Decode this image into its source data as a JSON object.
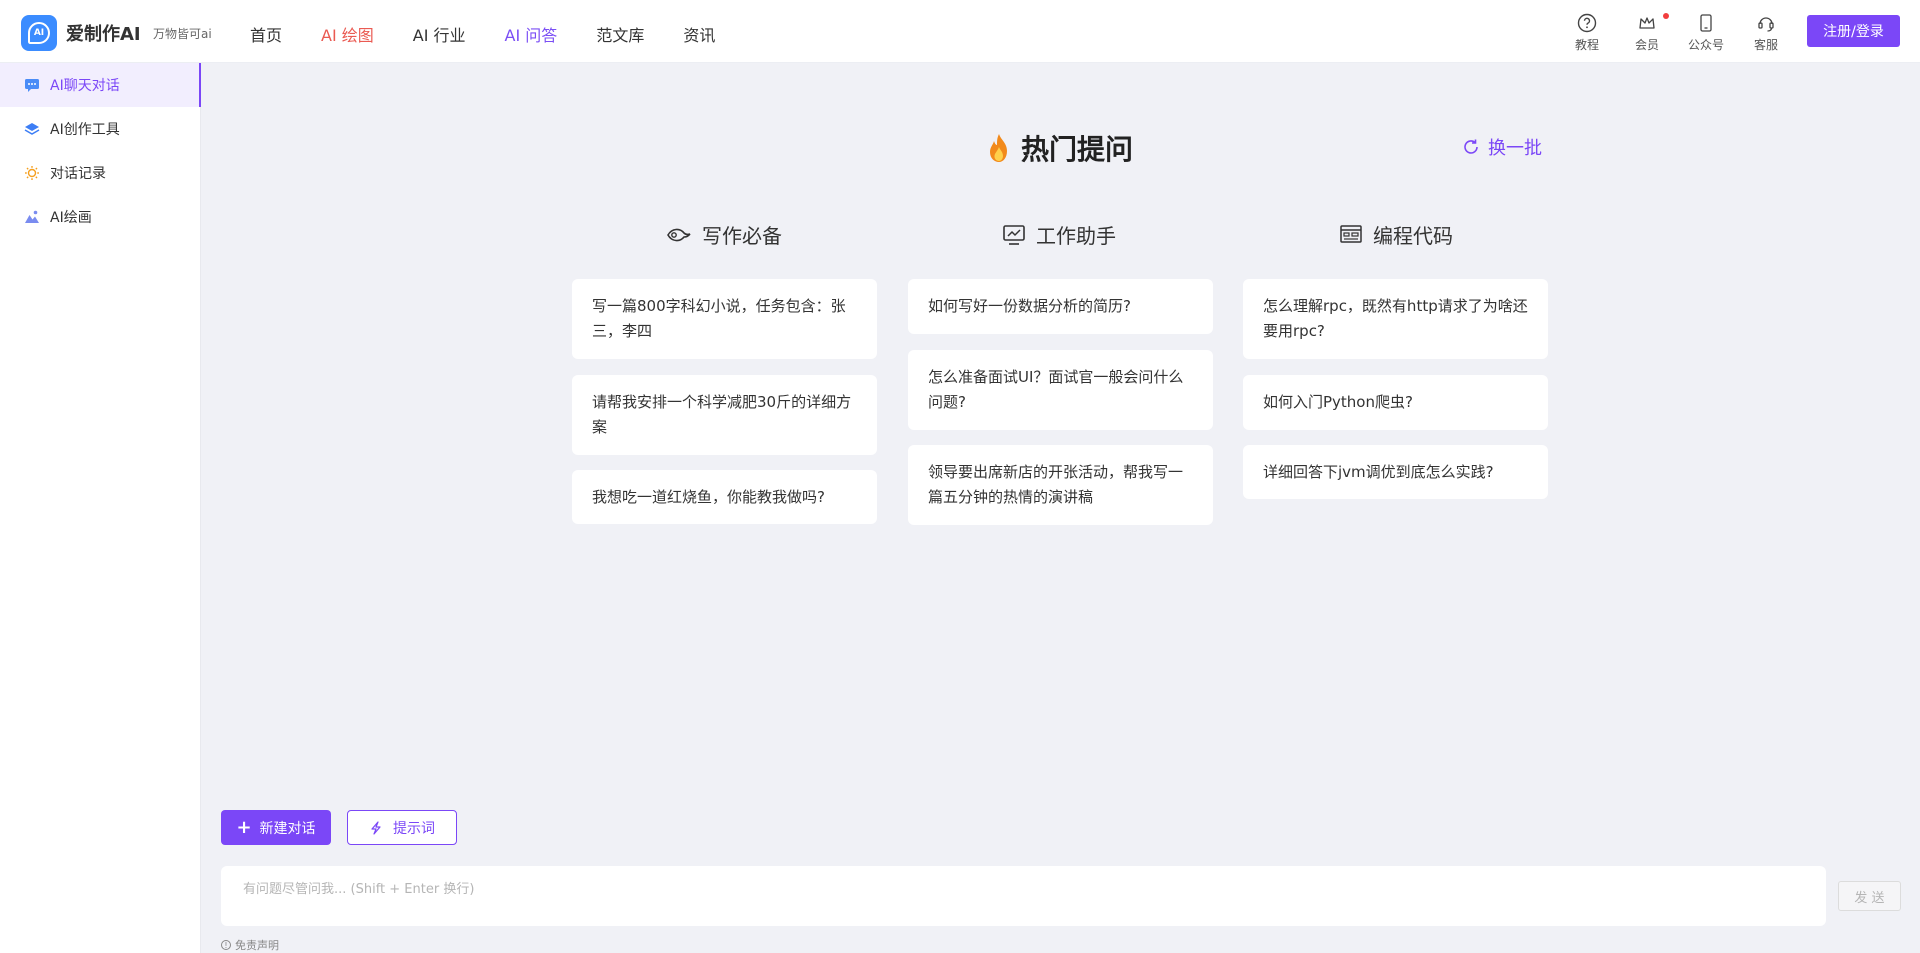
{
  "header": {
    "logo_text": "AI",
    "brand": "爱制作AI",
    "slogan": "万物皆可ai",
    "nav": [
      "首页",
      "AI 绘图",
      "AI 行业",
      "AI 问答",
      "范文库",
      "资讯"
    ],
    "tools": [
      "教程",
      "会员",
      "公众号",
      "客服"
    ],
    "login": "注册/登录"
  },
  "sidebar": {
    "items": [
      {
        "label": "AI聊天对话",
        "icon": "chat-icon"
      },
      {
        "label": "AI创作工具",
        "icon": "layers-icon"
      },
      {
        "label": "对话记录",
        "icon": "lightbulb-icon"
      },
      {
        "label": "AI绘画",
        "icon": "image-icon"
      }
    ]
  },
  "main": {
    "title": "热门提问",
    "refresh": "换一批",
    "columns": [
      {
        "title": "写作必备",
        "icon": "pen-icon",
        "cards": [
          "写一篇800字科幻小说，任务包含：张三，李四",
          "请帮我安排一个科学减肥30斤的详细方案",
          "我想吃一道红烧鱼，你能教我做吗?"
        ]
      },
      {
        "title": "工作助手",
        "icon": "monitor-icon",
        "cards": [
          "如何写好一份数据分析的简历?",
          "怎么准备面试UI？面试官一般会问什么问题?",
          "领导要出席新店的开张活动，帮我写一篇五分钟的热情的演讲稿"
        ]
      },
      {
        "title": "编程代码",
        "icon": "code-icon",
        "cards": [
          "怎么理解rpc，既然有http请求了为啥还要用rpc?",
          "如何入门Python爬虫?",
          "详细回答下jvm调优到底怎么实践?"
        ]
      }
    ]
  },
  "bottom": {
    "new_chat": "新建对话",
    "prompt": "提示词",
    "input_placeholder": "有问题尽管问我... (Shift + Enter 换行)",
    "send": "发 送",
    "disclaimer": "免责声明"
  },
  "colors": {
    "accent": "#7b47f7",
    "nav_red": "#ea5a52",
    "background": "#f0f1f6"
  }
}
